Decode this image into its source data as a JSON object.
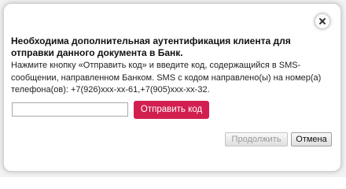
{
  "dialog": {
    "title": "Необходима дополнительная аутентификация клиента для отправки данного документа в Банк.",
    "description": "Нажмите кнопку «Отправить код» и введите код, содержащийся в SMS-сообщении, направленном Банком. SMS с кодом направлено(ы) на номер(а) телефона(ов): +7(926)xxx-xx-61,+7(905)xxx-xx-32.",
    "code_input": {
      "value": "",
      "placeholder": ""
    },
    "send_code_label": "Отправить код",
    "continue_label": "Продолжить",
    "continue_disabled": true,
    "cancel_label": "Отмена",
    "close_icon": "close-icon"
  },
  "colors": {
    "accent": "#d21f4f",
    "overlay": "#f2f2f2"
  }
}
